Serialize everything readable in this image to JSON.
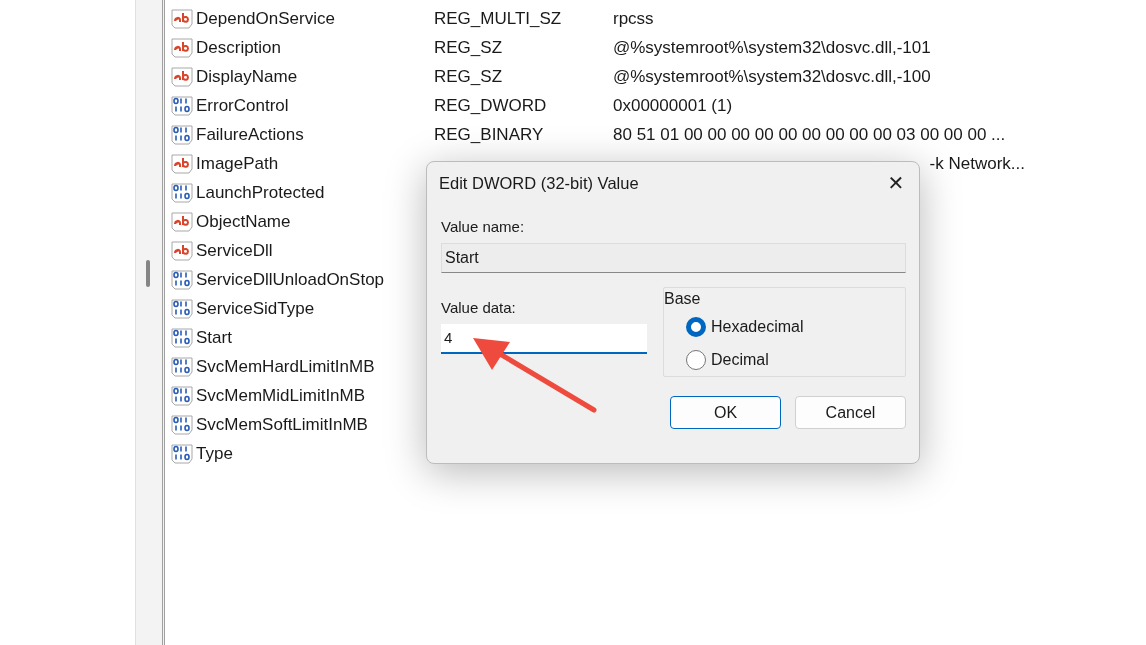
{
  "values": [
    {
      "kind": "string",
      "name": "DependOnService",
      "type": "REG_MULTI_SZ",
      "data": "rpcss"
    },
    {
      "kind": "string",
      "name": "Description",
      "type": "REG_SZ",
      "data": "@%systemroot%\\system32\\dosvc.dll,-101"
    },
    {
      "kind": "string",
      "name": "DisplayName",
      "type": "REG_SZ",
      "data": "@%systemroot%\\system32\\dosvc.dll,-100"
    },
    {
      "kind": "binary",
      "name": "ErrorControl",
      "type": "REG_DWORD",
      "data": "0x00000001 (1)"
    },
    {
      "kind": "binary",
      "name": "FailureActions",
      "type": "REG_BINARY",
      "data": "80 51 01 00 00 00 00 00 00 00 00 00 03 00 00 00 ..."
    },
    {
      "kind": "string",
      "name": "ImagePath",
      "data": "-k Network...",
      "covered": true
    },
    {
      "kind": "binary",
      "name": "LaunchProtected"
    },
    {
      "kind": "string",
      "name": "ObjectName"
    },
    {
      "kind": "string",
      "name": "ServiceDll"
    },
    {
      "kind": "binary",
      "name": "ServiceDllUnloadOnStop"
    },
    {
      "kind": "binary",
      "name": "ServiceSidType"
    },
    {
      "kind": "binary",
      "name": "Start"
    },
    {
      "kind": "binary",
      "name": "SvcMemHardLimitInMB"
    },
    {
      "kind": "binary",
      "name": "SvcMemMidLimitInMB"
    },
    {
      "kind": "binary",
      "name": "SvcMemSoftLimitInMB"
    },
    {
      "kind": "binary",
      "name": "Type"
    }
  ],
  "dialog": {
    "title": "Edit DWORD (32-bit) Value",
    "close": "✕",
    "name_label": "Value name:",
    "name_value": "Start",
    "data_label": "Value data:",
    "data_value": "4",
    "base_label": "Base",
    "base_options": [
      {
        "label": "Hexadecimal",
        "selected": true
      },
      {
        "label": "Decimal",
        "selected": false
      }
    ],
    "buttons": [
      {
        "label": "OK",
        "default": true
      },
      {
        "label": "Cancel",
        "default": false
      }
    ]
  }
}
